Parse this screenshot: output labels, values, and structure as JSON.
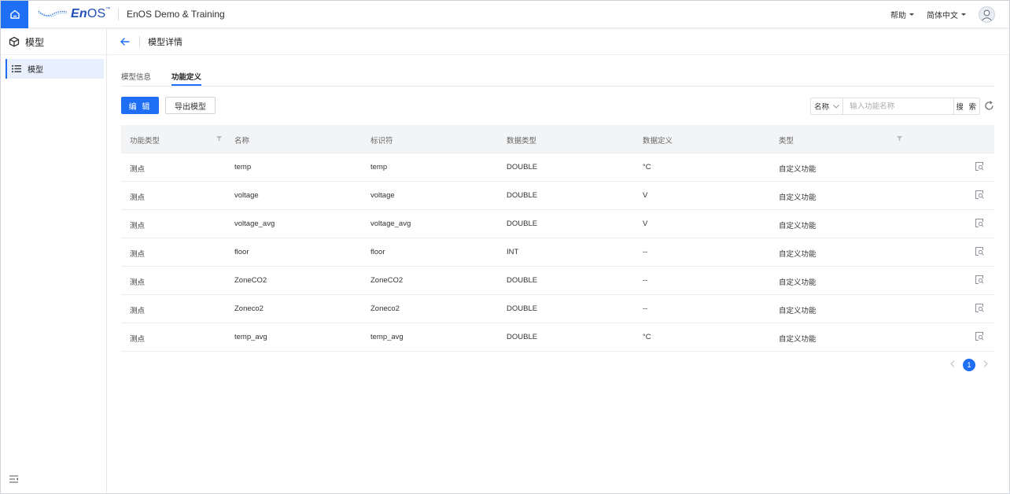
{
  "topbar": {
    "logo_text": "EnOS",
    "app_title": "EnOS Demo & Training",
    "help_label": "帮助",
    "language_label": "简体中文"
  },
  "sidebar": {
    "header_label": "模型",
    "items": [
      {
        "label": "模型",
        "icon": "list-icon",
        "active": true
      }
    ]
  },
  "page": {
    "title": "模型详情",
    "tabs": [
      {
        "label": "模型信息",
        "active": false
      },
      {
        "label": "功能定义",
        "active": true
      }
    ]
  },
  "toolbar": {
    "edit_label": "编 辑",
    "export_label": "导出模型",
    "search_field": "名称",
    "search_placeholder": "输入功能名称",
    "search_button": "搜 索"
  },
  "table": {
    "columns": [
      "功能类型",
      "名称",
      "标识符",
      "数据类型",
      "数据定义",
      "类型"
    ],
    "rows": [
      [
        "测点",
        "temp",
        "temp",
        "DOUBLE",
        "°C",
        "自定义功能"
      ],
      [
        "测点",
        "voltage",
        "voltage",
        "DOUBLE",
        "V",
        "自定义功能"
      ],
      [
        "测点",
        "voltage_avg",
        "voltage_avg",
        "DOUBLE",
        "V",
        "自定义功能"
      ],
      [
        "测点",
        "floor",
        "floor",
        "INT",
        "--",
        "自定义功能"
      ],
      [
        "测点",
        "ZoneCO2",
        "ZoneCO2",
        "DOUBLE",
        "--",
        "自定义功能"
      ],
      [
        "测点",
        "Zoneco2",
        "Zoneco2",
        "DOUBLE",
        "--",
        "自定义功能"
      ],
      [
        "测点",
        "temp_avg",
        "temp_avg",
        "DOUBLE",
        "°C",
        "自定义功能"
      ]
    ]
  },
  "pagination": {
    "current_page": "1"
  },
  "colors": {
    "accent": "#1f6ff5",
    "active_bg": "#e8f0fe",
    "header_bg": "#f3f4f6"
  }
}
